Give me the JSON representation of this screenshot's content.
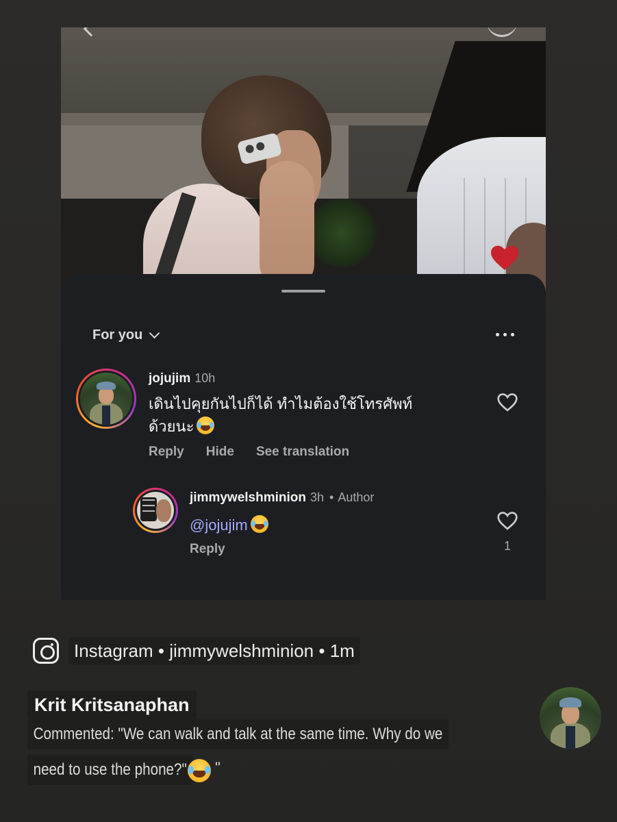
{
  "sheet": {
    "feed_filter": "For you",
    "comments": [
      {
        "username": "jojujim",
        "time": "10h",
        "text_line1": "เดินไปคุยกันไปก็ได้ ทำไมต้องใช้โทรศัพท์",
        "text_line2": "ด้วยนะ",
        "actions": [
          "Reply",
          "Hide",
          "See translation"
        ]
      }
    ],
    "replies": [
      {
        "username": "jimmywelshminion",
        "time": "3h",
        "badge": "Author",
        "mention": "@jojujim",
        "actions": [
          "Reply"
        ],
        "likes": "1"
      }
    ]
  },
  "share": {
    "source_app": "Instagram",
    "source_account": "jimmywelshminion",
    "source_age": "1m",
    "separator": "•",
    "commenter_name": "Krit Kritsanaphan",
    "comment_line1": "Commented: \"We can walk and talk at the same time. Why do we",
    "comment_line2": "need to use the phone?\"",
    "comment_trailing": "\""
  },
  "icons": {
    "feed_chevron": "chevron-down-icon",
    "more": "more-horizontal-icon",
    "like": "heart-outline-icon",
    "float_heart": "heart-filled-icon",
    "instagram": "instagram-icon",
    "emoji": "tears-of-joy-emoji"
  },
  "colors": {
    "background": "#292927",
    "sheet": "#1c1e21",
    "mention": "#a7a9ff",
    "heart_red": "#c8222c"
  }
}
